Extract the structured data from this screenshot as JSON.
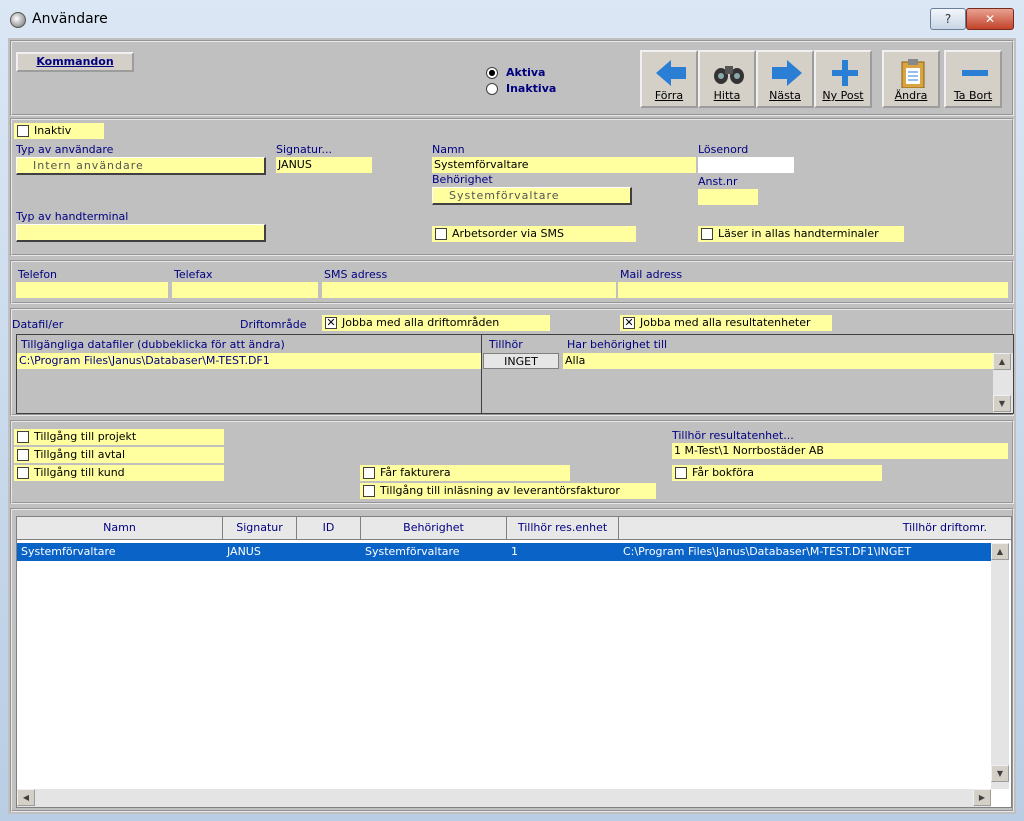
{
  "window": {
    "title": "Användare",
    "help_label": "?",
    "close_label": "✕"
  },
  "toolbar": {
    "kommandon_label": "Kommandon",
    "radio_aktiva": "Aktiva",
    "radio_inaktiva": "Inaktiva",
    "forra": "Förra",
    "hitta": "Hitta",
    "nasta": "Nästa",
    "ny_post": "Ny Post",
    "andra": "Ändra",
    "ta_bort": "Ta Bort"
  },
  "user": {
    "inaktiv_label": "Inaktiv",
    "typ_av_anvandare_label": "Typ av användare",
    "typ_av_anvandare_value": "Intern användare",
    "signatur_label": "Signatur...",
    "signatur_value": "JANUS",
    "namn_label": "Namn",
    "namn_value": "Systemförvaltare",
    "losenord_label": "Lösenord",
    "behorighet_label": "Behörighet",
    "behorighet_value": "Systemförvaltare",
    "anstnr_label": "Anst.nr",
    "typ_handterminal_label": "Typ av handterminal",
    "arbetsorder_sms_label": "Arbetsorder via SMS",
    "laser_in_label": "Läser in allas handterminaler"
  },
  "contact": {
    "telefon_label": "Telefon",
    "telefax_label": "Telefax",
    "sms_label": "SMS adress",
    "mail_label": "Mail adress"
  },
  "datafiles": {
    "datafil_label": "Datafil/er",
    "driftomrade_label": "Driftområde",
    "jobba_drift_label": "Jobba med alla driftområden",
    "jobba_res_label": "Jobba med alla resultatenheter",
    "col_files": "Tillgängliga datafiler (dubbeklicka för att ändra)",
    "col_tillhor": "Tillhör",
    "col_behorighet": "Har behörighet till",
    "file_value": "C:\\Program Files\\Janus\\Databaser\\M-TEST.DF1",
    "tillhor_value": "INGET",
    "behorighet_value": "Alla"
  },
  "access": {
    "projekt_label": "Tillgång till projekt",
    "avtal_label": "Tillgång till avtal",
    "kund_label": "Tillgång till kund",
    "fakturera_label": "Får fakturera",
    "inlasning_label": "Tillgång till inläsning av leverantörsfakturor",
    "tillhor_res_label": "Tillhör resultatenhet...",
    "tillhor_res_value": "1  M-Test\\1  Norrbostäder AB",
    "bokfora_label": "Får bokföra"
  },
  "grid": {
    "headers": [
      "Namn",
      "Signatur",
      "ID",
      "Behörighet",
      "Tillhör res.enhet",
      "Tillhör driftomr."
    ],
    "rows": [
      [
        "Systemförvaltare",
        "JANUS",
        "",
        "Systemförvaltare",
        "1",
        "C:\\Program Files\\Janus\\Databaser\\M-TEST.DF1\\INGET"
      ]
    ]
  },
  "colors": {
    "field_yellow": "#ffffa0",
    "label_navy": "#000080",
    "selection_blue": "#0a64c8",
    "icon_blue": "#2a7fd4"
  }
}
